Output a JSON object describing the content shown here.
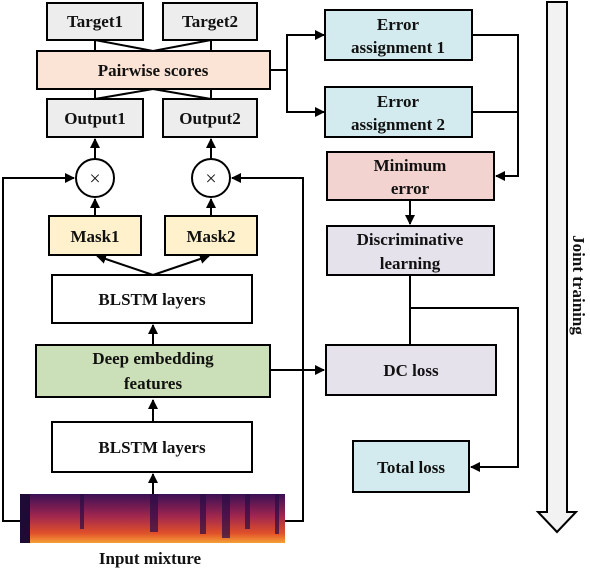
{
  "nodes": {
    "target1": "Target1",
    "target2": "Target2",
    "pairwise": "Pairwise scores",
    "output1": "Output1",
    "output2": "Output2",
    "multiply_symbol": "×",
    "mask1": "Mask1",
    "mask2": "Mask2",
    "blstm_top": "BLSTM layers",
    "embedding_line1": "Deep embedding",
    "embedding_line2": "features",
    "blstm_bottom": "BLSTM layers",
    "input": "Input mixture",
    "error1_line1": "Error",
    "error1_line2": "assignment 1",
    "error2_line1": "Error",
    "error2_line2": "assignment 2",
    "min_error_line1": "Minimum",
    "min_error_line2": "error",
    "disc_line1": "Discriminative",
    "disc_line2": "learning",
    "dc_loss": "DC loss",
    "total_loss": "Total loss",
    "joint_training": "Joint training"
  },
  "colors": {
    "target_output": "#ededed",
    "pairwise": "#fbe3d5",
    "mask": "#fff1cc",
    "embedding": "#cbdfb8",
    "dc_loss": "#e6e2ec",
    "error": "#d3ebee",
    "min_error": "#f3d3cf",
    "discriminative": "#e6e2ec",
    "total_loss": "#d3ebee"
  }
}
